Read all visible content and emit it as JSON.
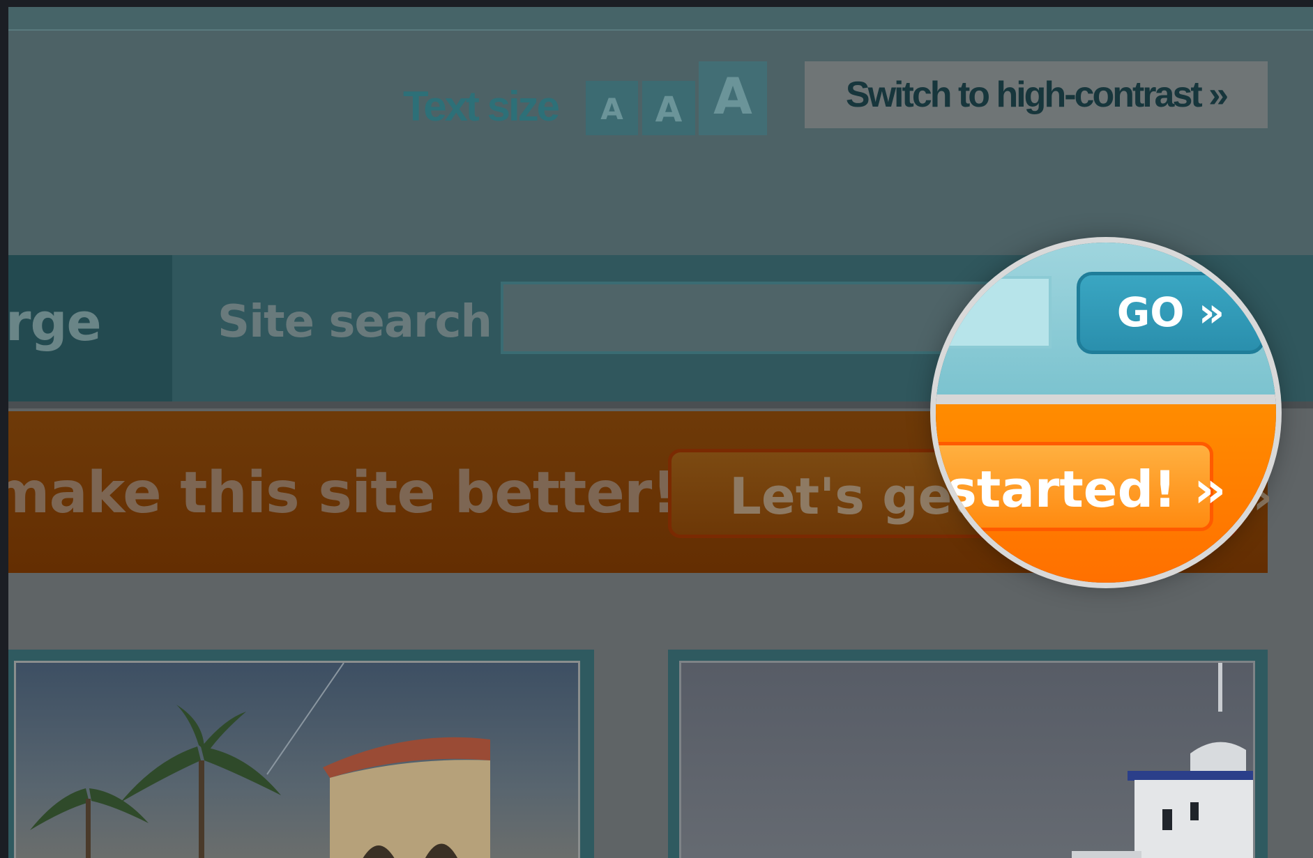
{
  "accessibility": {
    "text_size_label": "Text size",
    "size_small": "A",
    "size_medium": "A",
    "size_large": "A",
    "contrast_button": "Switch to high-contrast »"
  },
  "nav": {
    "partial_item": "rge"
  },
  "search": {
    "label": "Site search",
    "input_value": "",
    "go_button": "GO »"
  },
  "promo": {
    "text": "make this site better!",
    "button_label": "Let's get started! »",
    "button_label_magnified": "started! »"
  },
  "colors": {
    "go_button": "#2a8fad",
    "promo_orange": "#ff8000",
    "nav_teal": "#30575d"
  }
}
